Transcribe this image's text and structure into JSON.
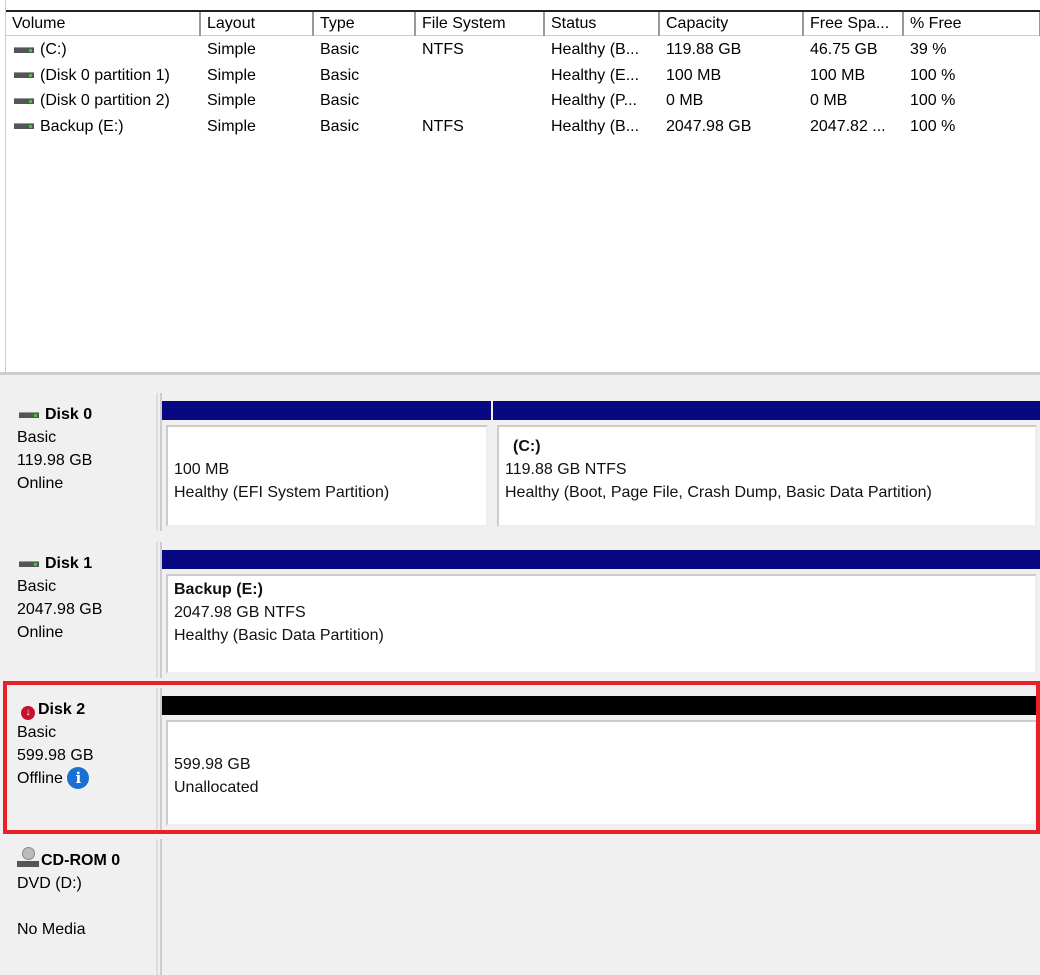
{
  "columns": [
    "Volume",
    "Layout",
    "Type",
    "File System",
    "Status",
    "Capacity",
    "Free Spa...",
    "% Free"
  ],
  "volumes": [
    [
      "(C:)",
      "Simple",
      "Basic",
      "NTFS",
      "Healthy (B...",
      "119.88 GB",
      "46.75 GB",
      "39 %"
    ],
    [
      "(Disk 0 partition 1)",
      "Simple",
      "Basic",
      "",
      "Healthy (E...",
      "100 MB",
      "100 MB",
      "100 %"
    ],
    [
      "(Disk 0 partition 2)",
      "Simple",
      "Basic",
      "",
      "Healthy (P...",
      "0 MB",
      "0 MB",
      "100 %"
    ],
    [
      "Backup (E:)",
      "Simple",
      "Basic",
      "NTFS",
      "Healthy (B...",
      "2047.98 GB",
      "2047.82 ...",
      "100 %"
    ]
  ],
  "disks": [
    {
      "name": "Disk 0",
      "type": "Basic",
      "size": "119.98 GB",
      "status": "Online",
      "partitions": [
        {
          "title": "",
          "size": "100 MB",
          "status": "Healthy (EFI System Partition)"
        },
        {
          "title": "(C:)",
          "size": "119.88 GB NTFS",
          "status": "Healthy (Boot, Page File, Crash Dump, Basic Data Partition)"
        }
      ]
    },
    {
      "name": "Disk 1",
      "type": "Basic",
      "size": "2047.98 GB",
      "status": "Online",
      "partitions": [
        {
          "title": "Backup  (E:)",
          "size": "2047.98 GB NTFS",
          "status": "Healthy (Basic Data Partition)"
        }
      ]
    },
    {
      "name": "Disk 2",
      "type": "Basic",
      "size": "599.98 GB",
      "status": "Offline",
      "partitions": [
        {
          "size": "599.98 GB",
          "status": "Unallocated"
        }
      ]
    },
    {
      "name": "CD-ROM 0",
      "type": "DVD (D:)",
      "status": "No Media"
    }
  ],
  "colors": {
    "primary_bar": "#080880",
    "unallocated_bar": "#000000",
    "highlight": "#e8202a",
    "info": "#1a6fd0"
  }
}
